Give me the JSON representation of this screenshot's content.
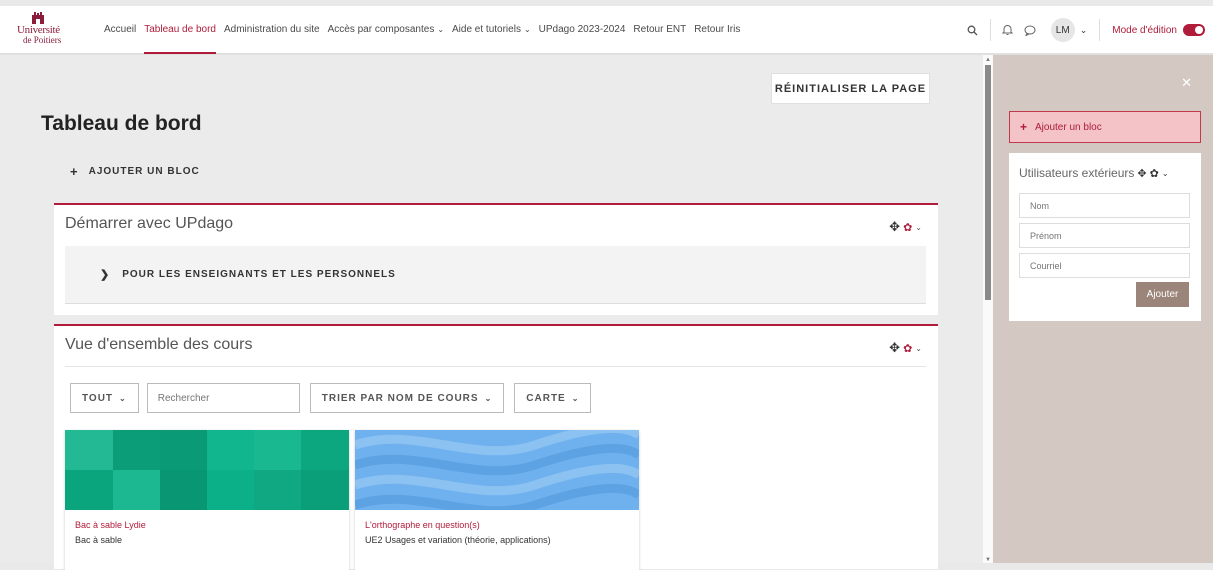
{
  "logo": {
    "line1": "Université",
    "line2": "de Poitiers"
  },
  "nav": {
    "items": [
      {
        "label": "Accueil",
        "dropdown": false,
        "active": false
      },
      {
        "label": "Tableau de bord",
        "dropdown": false,
        "active": true
      },
      {
        "label": "Administration du site",
        "dropdown": false,
        "active": false
      },
      {
        "label": "Accès par composantes",
        "dropdown": true,
        "active": false
      },
      {
        "label": "Aide et tutoriels",
        "dropdown": true,
        "active": false
      },
      {
        "label": "UPdago 2023-2024",
        "dropdown": false,
        "active": false
      },
      {
        "label": "Retour ENT",
        "dropdown": false,
        "active": false
      },
      {
        "label": "Retour Iris",
        "dropdown": false,
        "active": false
      }
    ],
    "user_initials": "LM",
    "edit_mode_label": "Mode d'édition",
    "edit_mode_on": true
  },
  "main": {
    "reset_label": "RÉINITIALISER LA PAGE",
    "page_title": "Tableau de bord",
    "add_block_label": "AJOUTER UN BLOC",
    "block1": {
      "title": "Démarrer avec UPdago",
      "section_label": "POUR LES ENSEIGNANTS ET LES PERSONNELS"
    },
    "block2": {
      "title": "Vue d'ensemble des cours",
      "filter_all": "TOUT",
      "search_placeholder": "Rechercher",
      "sort_label": "TRIER PAR NOM DE COURS",
      "view_label": "CARTE",
      "courses": [
        {
          "title": "Bac à sable Lydie",
          "category": "Bac à sable"
        },
        {
          "title": "L'orthographe en question(s)",
          "category": "UE2 Usages et variation (théorie, applications)"
        }
      ]
    }
  },
  "drawer": {
    "add_block_label": "Ajouter un bloc",
    "ext_users": {
      "title": "Utilisateurs extérieurs",
      "nom_placeholder": "Nom",
      "prenom_placeholder": "Prénom",
      "courriel_placeholder": "Courriel",
      "submit_label": "Ajouter"
    }
  },
  "colors": {
    "accent": "#b01c3a",
    "drawer_bg": "#d4c9c2",
    "card1_green": "#0fb48b",
    "card2_blue": "#6fb1ee"
  },
  "icons": [
    "search-icon",
    "bell-icon",
    "chat-icon",
    "chevron-down-icon",
    "move-icon",
    "gear-icon",
    "close-icon",
    "plus-icon",
    "chevron-right-icon"
  ]
}
